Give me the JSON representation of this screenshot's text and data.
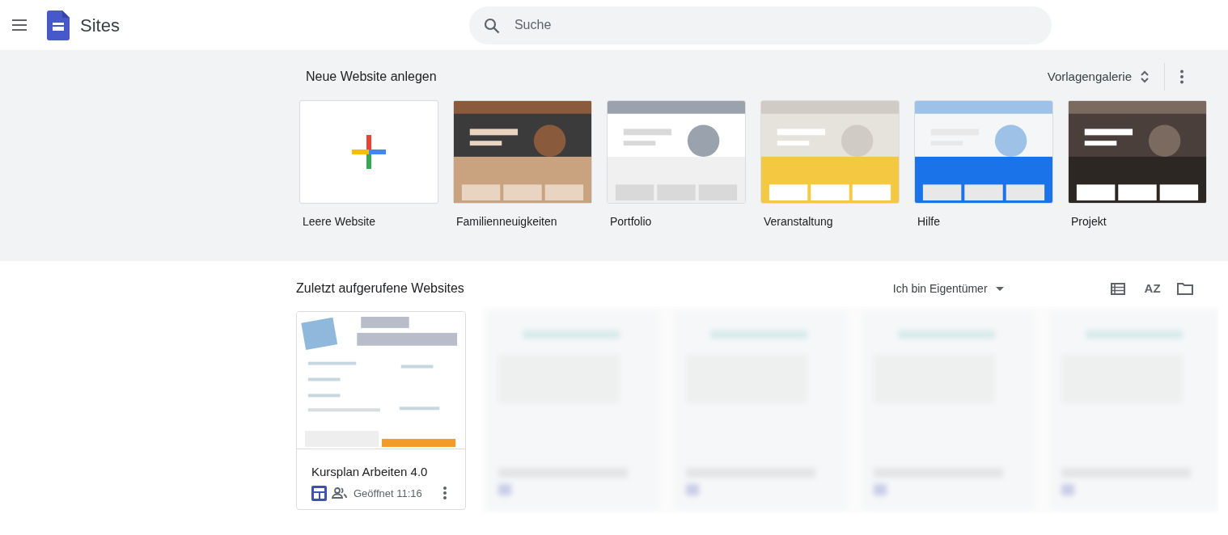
{
  "header": {
    "app_name": "Sites",
    "search": {
      "placeholder": "Suche"
    }
  },
  "new_site": {
    "title": "Neue Website anlegen",
    "gallery_button": "Vorlagengalerie",
    "templates": [
      {
        "label": "Leere Website",
        "kind": "blank"
      },
      {
        "label": "Familienneuigkeiten",
        "kind": "picture"
      },
      {
        "label": "Portfolio",
        "kind": "picture"
      },
      {
        "label": "Veranstaltung",
        "kind": "picture"
      },
      {
        "label": "Hilfe",
        "kind": "picture"
      },
      {
        "label": "Projekt",
        "kind": "picture"
      }
    ]
  },
  "recent": {
    "title": "Zuletzt aufgerufene Websites",
    "owner_filter": "Ich bin Eigentümer",
    "sort_label": "AZ",
    "sites": [
      {
        "title": "Kursplan Arbeiten 4.0",
        "opened": "Geöffnet 11:16",
        "shared": true
      }
    ]
  }
}
